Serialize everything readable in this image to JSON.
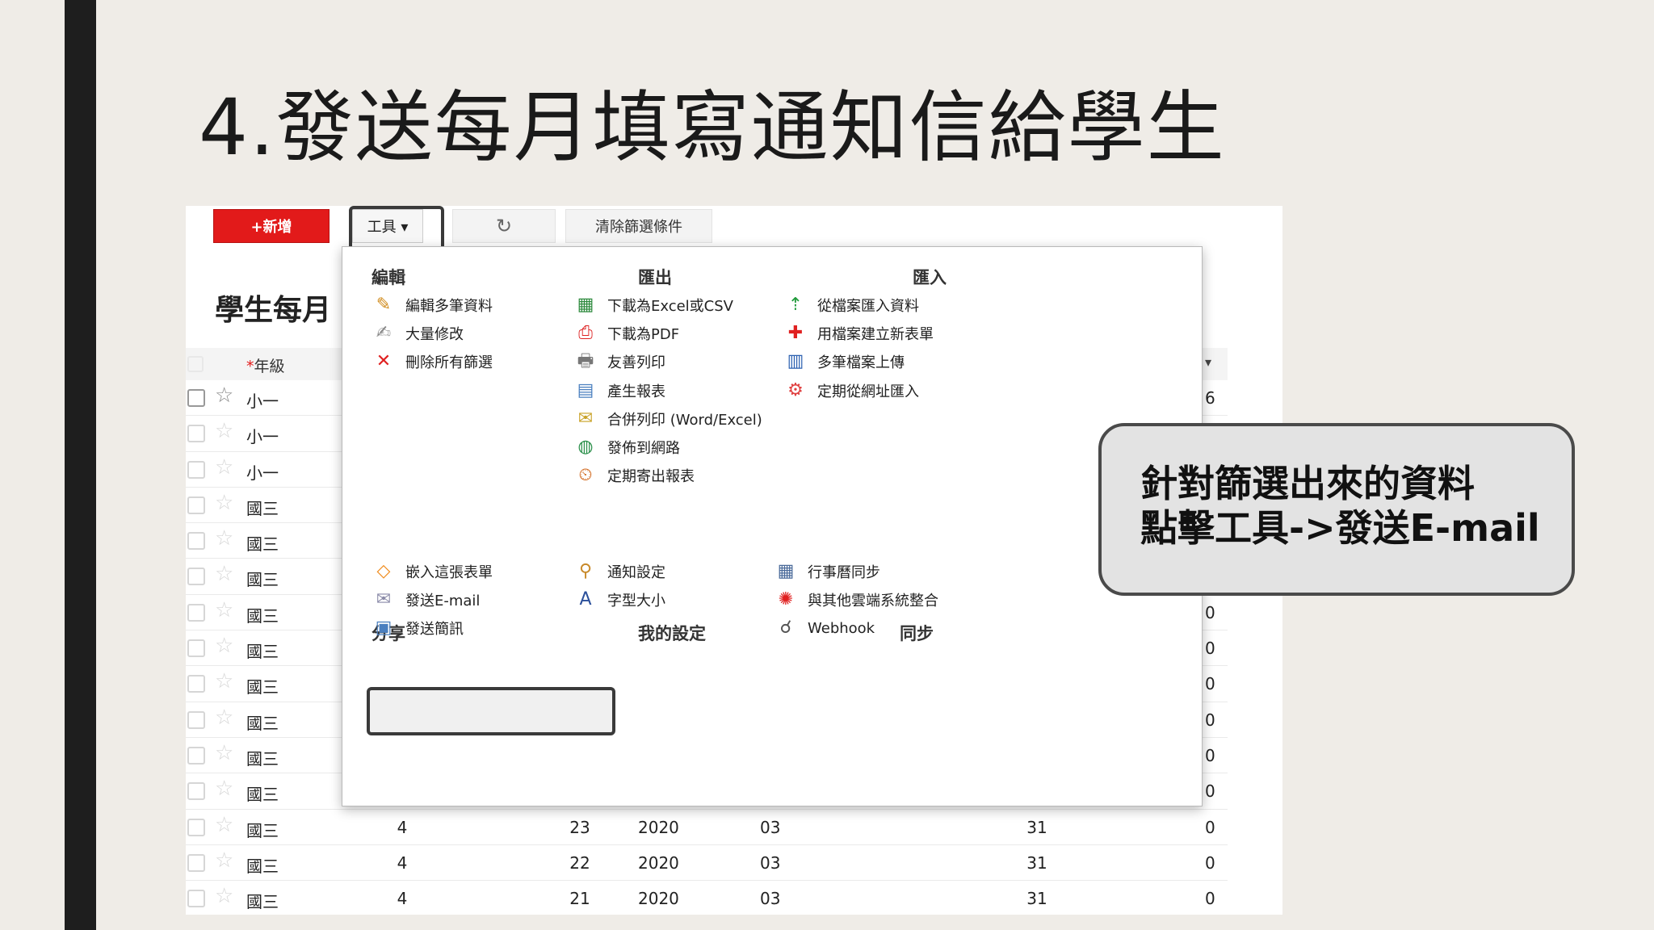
{
  "slide": {
    "title": "4.發送每月填寫通知信給學生"
  },
  "toolbar": {
    "new_label": "+新增",
    "tools_label": "工具 ▾",
    "refresh_icon": "↻",
    "clear_label": "清除篩選條件"
  },
  "app": {
    "title": "學生每月",
    "header_grade": "年級",
    "header_required": "*",
    "header_dropdown": "▾"
  },
  "table": {
    "rows": [
      {
        "grade": "小一",
        "a": "",
        "b": "",
        "c": "",
        "d": "",
        "e": "",
        "f": "6"
      },
      {
        "grade": "小一",
        "a": "",
        "b": "",
        "c": "",
        "d": "",
        "e": "",
        "f": ""
      },
      {
        "grade": "小一",
        "a": "",
        "b": "",
        "c": "",
        "d": "",
        "e": "",
        "f": ""
      },
      {
        "grade": "國三",
        "a": "",
        "b": "",
        "c": "",
        "d": "",
        "e": "",
        "f": ""
      },
      {
        "grade": "國三",
        "a": "",
        "b": "",
        "c": "",
        "d": "",
        "e": "",
        "f": ""
      },
      {
        "grade": "國三",
        "a": "",
        "b": "",
        "c": "",
        "d": "",
        "e": "",
        "f": ""
      },
      {
        "grade": "國三",
        "a": "",
        "b": "",
        "c": "",
        "d": "",
        "e": "",
        "f": "0"
      },
      {
        "grade": "國三",
        "a": "",
        "b": "",
        "c": "",
        "d": "",
        "e": "",
        "f": "0"
      },
      {
        "grade": "國三",
        "a": "",
        "b": "",
        "c": "",
        "d": "",
        "e": "",
        "f": "0"
      },
      {
        "grade": "國三",
        "a": "",
        "b": "",
        "c": "",
        "d": "",
        "e": "",
        "f": "0"
      },
      {
        "grade": "國三",
        "a": "",
        "b": "",
        "c": "",
        "d": "",
        "e": "",
        "f": "0"
      },
      {
        "grade": "國三",
        "a": "",
        "b": "",
        "c": "",
        "d": "",
        "e": "",
        "f": "0"
      },
      {
        "grade": "國三",
        "a": "4",
        "b": "23",
        "c": "2020",
        "d": "03",
        "e": "31",
        "f": "0"
      },
      {
        "grade": "國三",
        "a": "4",
        "b": "22",
        "c": "2020",
        "d": "03",
        "e": "31",
        "f": "0"
      },
      {
        "grade": "國三",
        "a": "4",
        "b": "21",
        "c": "2020",
        "d": "03",
        "e": "31",
        "f": "0"
      }
    ]
  },
  "menu": {
    "edit": {
      "title": "編輯",
      "items": [
        {
          "icon": "pencil-icon",
          "glyph": "✎",
          "color": "#d08a1a",
          "label": "編輯多筆資料"
        },
        {
          "icon": "bulk-edit-icon",
          "glyph": "✍",
          "color": "#888888",
          "label": "大量修改"
        },
        {
          "icon": "delete-icon",
          "glyph": "✕",
          "color": "#e02020",
          "label": "刪除所有篩選"
        }
      ]
    },
    "export": {
      "title": "匯出",
      "items": [
        {
          "icon": "excel-icon",
          "glyph": "▦",
          "color": "#2e8b3e",
          "label": "下載為Excel或CSV"
        },
        {
          "icon": "pdf-icon",
          "glyph": "⎙",
          "color": "#d22",
          "label": "下載為PDF"
        },
        {
          "icon": "printer-icon",
          "glyph": "🖶",
          "color": "#777777",
          "label": "友善列印"
        },
        {
          "icon": "report-icon",
          "glyph": "▤",
          "color": "#4a7fbf",
          "label": "產生報表"
        },
        {
          "icon": "merge-print-icon",
          "glyph": "✉",
          "color": "#c9a227",
          "label": "合併列印 (Word/Excel)"
        },
        {
          "icon": "globe-icon",
          "glyph": "◍",
          "color": "#2a8f4a",
          "label": "發佈到網路"
        },
        {
          "icon": "schedule-report-icon",
          "glyph": "⏲",
          "color": "#d2691e",
          "label": "定期寄出報表"
        }
      ]
    },
    "import": {
      "title": "匯入",
      "items": [
        {
          "icon": "file-import-icon",
          "glyph": "⇡",
          "color": "#1f9a3a",
          "label": "從檔案匯入資料"
        },
        {
          "icon": "new-sheet-icon",
          "glyph": "✚",
          "color": "#e02020",
          "label": "用檔案建立新表單"
        },
        {
          "icon": "multi-upload-icon",
          "glyph": "▥",
          "color": "#2a5fb0",
          "label": "多筆檔案上傳"
        },
        {
          "icon": "url-import-icon",
          "glyph": "⚙",
          "color": "#e04040",
          "label": "定期從網址匯入"
        }
      ]
    },
    "share": {
      "title": "分享",
      "items": [
        {
          "icon": "embed-icon",
          "glyph": "◇",
          "color": "#f08a1a",
          "label": "嵌入這張表單"
        },
        {
          "icon": "email-icon",
          "glyph": "✉",
          "color": "#8a8aa8",
          "label": "發送E-mail"
        },
        {
          "icon": "sms-icon",
          "glyph": "▣",
          "color": "#4a7fbf",
          "label": "發送簡訊"
        }
      ]
    },
    "settings": {
      "title": "我的設定",
      "items": [
        {
          "icon": "glasses-icon",
          "glyph": "⚲",
          "color": "#c88a2a",
          "label": "通知設定"
        },
        {
          "icon": "font-size-icon",
          "glyph": "A",
          "color": "#2a4f9a",
          "label": "字型大小"
        }
      ]
    },
    "sync": {
      "title": "同步",
      "items": [
        {
          "icon": "calendar-icon",
          "glyph": "▦",
          "color": "#4a6a9a",
          "label": "行事曆同步"
        },
        {
          "icon": "cloud-integration-icon",
          "glyph": "✺",
          "color": "#e02020",
          "label": "與其他雲端系統整合"
        },
        {
          "icon": "webhook-icon",
          "glyph": "☌",
          "color": "#555555",
          "label": "Webhook"
        }
      ]
    }
  },
  "callout": {
    "line1": "針對篩選出來的資料",
    "line2": "點擊工具->發送E-mail"
  }
}
